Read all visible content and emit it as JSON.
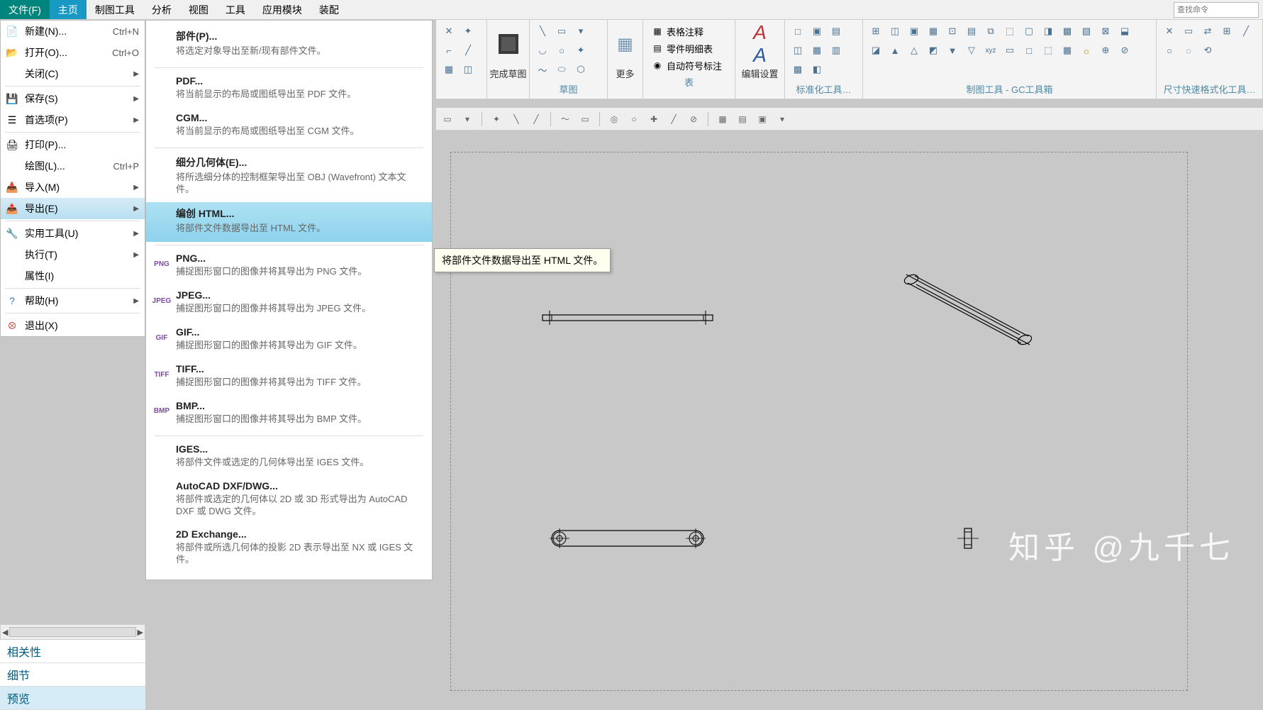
{
  "menubar": [
    "文件(F)",
    "主页",
    "制图工具",
    "分析",
    "视图",
    "工具",
    "应用模块",
    "装配"
  ],
  "search_placeholder": "查找命令",
  "file_menu": [
    {
      "label": "新建(N)...",
      "sc": "Ctrl+N",
      "icon": "new"
    },
    {
      "label": "打开(O)...",
      "sc": "Ctrl+O",
      "icon": "open"
    },
    {
      "label": "关闭(C)",
      "arrow": true
    },
    {
      "sep": true
    },
    {
      "label": "保存(S)",
      "arrow": true,
      "icon": "save"
    },
    {
      "label": "首选项(P)",
      "arrow": true,
      "icon": "prefs"
    },
    {
      "sep": true
    },
    {
      "label": "打印(P)...",
      "icon": "print"
    },
    {
      "label": "绘图(L)...",
      "sc": "Ctrl+P"
    },
    {
      "label": "导入(M)",
      "arrow": true,
      "icon": "import"
    },
    {
      "label": "导出(E)",
      "arrow": true,
      "selected": true,
      "icon": "export"
    },
    {
      "sep": true
    },
    {
      "label": "实用工具(U)",
      "arrow": true,
      "icon": "util"
    },
    {
      "label": "执行(T)",
      "arrow": true
    },
    {
      "label": "属性(I)"
    },
    {
      "sep": true
    },
    {
      "label": "帮助(H)",
      "arrow": true,
      "icon": "help"
    },
    {
      "sep": true
    },
    {
      "label": "退出(X)",
      "icon": "exit"
    }
  ],
  "export_menu": [
    {
      "title": "部件(P)...",
      "desc": "将选定对象导出至新/现有部件文件。"
    },
    {
      "sep": true
    },
    {
      "title": "PDF...",
      "desc": "将当前显示的布局或图纸导出至 PDF 文件。"
    },
    {
      "title": "CGM...",
      "desc": "将当前显示的布局或图纸导出至 CGM 文件。"
    },
    {
      "sep": true
    },
    {
      "title": "细分几何体(E)...",
      "desc": "将所选细分体的控制框架导出至 OBJ (Wavefront) 文本文件。"
    },
    {
      "title": "编创 HTML...",
      "desc": "将部件文件数据导出至 HTML 文件。",
      "selected": true
    },
    {
      "sep": true
    },
    {
      "title": "PNG...",
      "desc": "捕捉图形窗口的图像并将其导出为 PNG 文件。",
      "icon": "PNG"
    },
    {
      "title": "JPEG...",
      "desc": "捕捉图形窗口的图像并将其导出为 JPEG 文件。",
      "icon": "JPEG"
    },
    {
      "title": "GIF...",
      "desc": "捕捉图形窗口的图像并将其导出为 GIF 文件。",
      "icon": "GIF"
    },
    {
      "title": "TIFF...",
      "desc": "捕捉图形窗口的图像并将其导出为 TIFF 文件。",
      "icon": "TIFF"
    },
    {
      "title": "BMP...",
      "desc": "捕捉图形窗口的图像并将其导出为 BMP 文件。",
      "icon": "BMP"
    },
    {
      "sep": true
    },
    {
      "title": "IGES...",
      "desc": "将部件文件或选定的几何体导出至 IGES 文件。"
    },
    {
      "title": "AutoCAD DXF/DWG...",
      "desc": "将部件或选定的几何体以 2D 或 3D 形式导出为 AutoCAD DXF 或 DWG 文件。"
    },
    {
      "title": "2D Exchange...",
      "desc": "将部件或所选几何体的投影 2D 表示导出至 NX 或 IGES 文件。"
    }
  ],
  "tooltip": "将部件文件数据导出至 HTML 文件。",
  "ribbon": {
    "finish_sketch": "完成草图",
    "more": "更多",
    "table_note": "表格注释",
    "parts_list": "零件明细表",
    "auto_balloon": "自动符号标注",
    "edit_settings": "编辑设置",
    "group_sketch": "草图",
    "group_table": "表",
    "group_std": "标准化工具…",
    "group_gc": "制图工具 - GC工具箱",
    "group_dim": "尺寸快速格式化工具…"
  },
  "bottom_tabs": [
    "相关性",
    "细节",
    "预览"
  ],
  "watermark": "知乎 @九千七"
}
